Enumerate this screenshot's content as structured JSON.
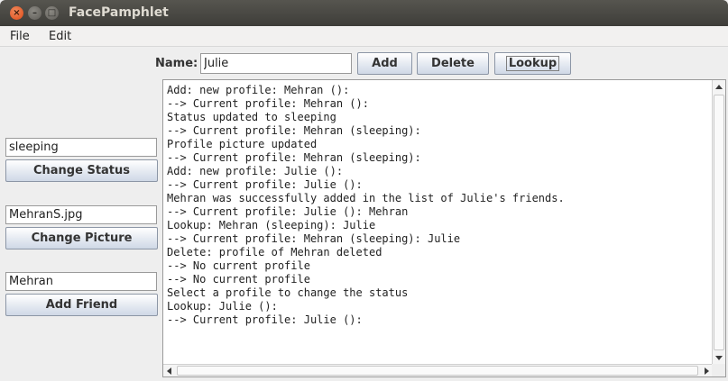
{
  "window": {
    "title": "FacePamphlet"
  },
  "menu": {
    "items": [
      "File",
      "Edit"
    ]
  },
  "toolbar": {
    "name_label": "Name:",
    "name_value": "Julie",
    "add_label": "Add",
    "delete_label": "Delete",
    "lookup_label": "Lookup"
  },
  "west": {
    "status_value": "sleeping",
    "change_status_label": "Change Status",
    "picture_value": "MehranS.jpg",
    "change_picture_label": "Change Picture",
    "friend_value": "Mehran",
    "add_friend_label": "Add Friend"
  },
  "output": {
    "lines": [
      "Add: new profile: Mehran ():",
      "--> Current profile: Mehran ():",
      "Status updated to sleeping",
      "--> Current profile: Mehran (sleeping):",
      "Profile picture updated",
      "--> Current profile: Mehran (sleeping):",
      "Add: new profile: Julie ():",
      "--> Current profile: Julie ():",
      "Mehran was successfully added in the list of Julie's friends.",
      "--> Current profile: Julie (): Mehran",
      "Lookup: Mehran (sleeping): Julie",
      "--> Current profile: Mehran (sleeping): Julie",
      "Delete: profile of Mehran deleted",
      "--> No current profile",
      "--> No current profile",
      "Select a profile to change the status",
      "Lookup: Julie ():",
      "--> Current profile: Julie ():"
    ]
  }
}
